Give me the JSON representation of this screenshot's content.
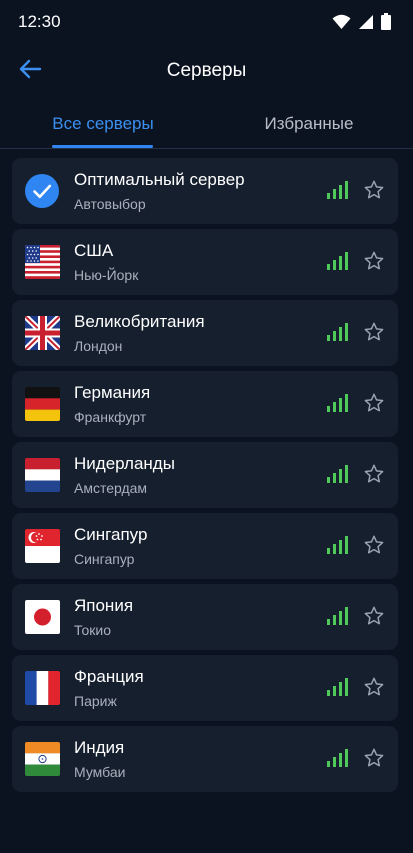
{
  "status_bar": {
    "time": "12:30",
    "icons": [
      "wifi-icon",
      "cellular-signal-icon",
      "battery-icon"
    ]
  },
  "header": {
    "title": "Серверы",
    "back_icon": "arrow-left-icon"
  },
  "tabs": [
    {
      "label": "Все серверы",
      "active": true
    },
    {
      "label": "Избранные",
      "active": false
    }
  ],
  "colors": {
    "background": "#0c1320",
    "card": "#161f2e",
    "accent": "#2f86f2",
    "signal": "#4ec95a",
    "secondary_text": "#aab0bc"
  },
  "servers": [
    {
      "name": "Оптимальный сервер",
      "subtitle": "Автовыбор",
      "icon": "check-circle-icon",
      "selected": true,
      "signal_bars": 4,
      "favorite": false
    },
    {
      "name": "США",
      "subtitle": "Нью-Йорк",
      "icon": "flag-usa-icon",
      "selected": false,
      "signal_bars": 4,
      "favorite": false
    },
    {
      "name": "Великобритания",
      "subtitle": "Лондон",
      "icon": "flag-uk-icon",
      "selected": false,
      "signal_bars": 4,
      "favorite": false
    },
    {
      "name": "Германия",
      "subtitle": "Франкфурт",
      "icon": "flag-germany-icon",
      "selected": false,
      "signal_bars": 4,
      "favorite": false
    },
    {
      "name": "Нидерланды",
      "subtitle": "Амстердам",
      "icon": "flag-netherlands-icon",
      "selected": false,
      "signal_bars": 4,
      "favorite": false
    },
    {
      "name": "Сингапур",
      "subtitle": "Сингапур",
      "icon": "flag-singapore-icon",
      "selected": false,
      "signal_bars": 4,
      "favorite": false
    },
    {
      "name": "Япония",
      "subtitle": "Токио",
      "icon": "flag-japan-icon",
      "selected": false,
      "signal_bars": 4,
      "favorite": false
    },
    {
      "name": "Франция",
      "subtitle": "Париж",
      "icon": "flag-france-icon",
      "selected": false,
      "signal_bars": 4,
      "favorite": false
    },
    {
      "name": "Индия",
      "subtitle": "Мумбаи",
      "icon": "flag-india-icon",
      "selected": false,
      "signal_bars": 4,
      "favorite": false
    }
  ]
}
